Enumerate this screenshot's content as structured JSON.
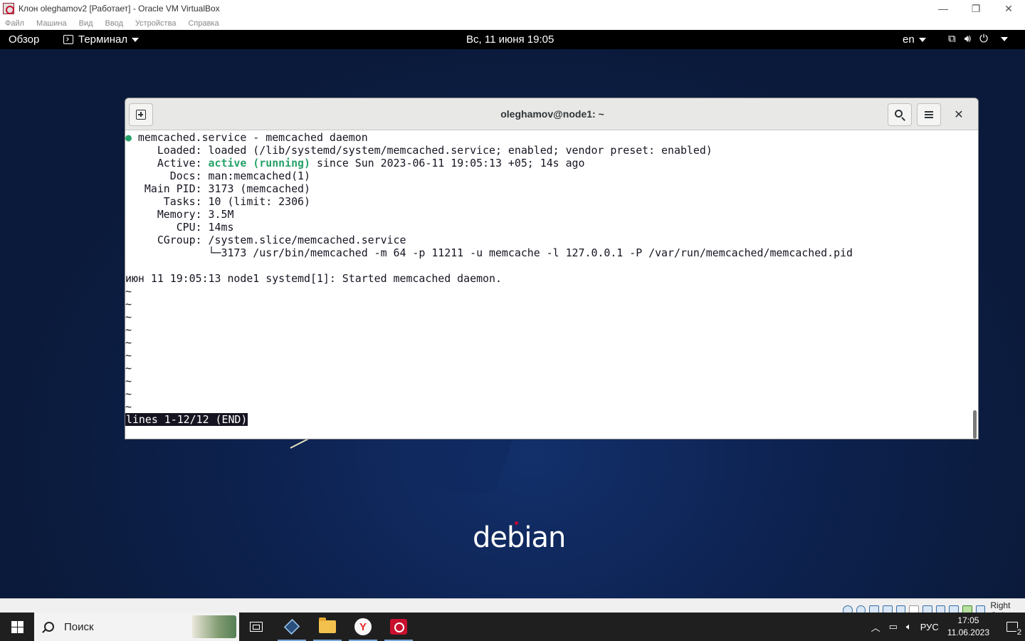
{
  "host_window": {
    "title": "Клон oleghamov2 [Работает] - Oracle VM VirtualBox",
    "controls": [
      "—",
      "❐",
      "✕"
    ]
  },
  "host_menu": [
    "Файл",
    "Машина",
    "Вид",
    "Ввод",
    "Устройства",
    "Справка"
  ],
  "gnome_bar": {
    "overview": "Обзор",
    "app_menu": "Терминал",
    "clock": "Вс, 11 июня  19:05",
    "lang": "en",
    "status_icons": [
      "network-icon",
      "volume-icon",
      "power-icon"
    ]
  },
  "terminal": {
    "title": "oleghamov@node1: ~",
    "lines": [
      {
        "pre": " memcached.service - memcached daemon",
        "dot": "●"
      },
      {
        "text": "     Loaded: loaded (/lib/systemd/system/memcached.service; enabled; vendor preset: enabled)"
      },
      {
        "pre": "     Active: ",
        "green": "active (running)",
        "post": " since Sun 2023-06-11 19:05:13 +05; 14s ago"
      },
      {
        "text": "       Docs: man:memcached(1)"
      },
      {
        "text": "   Main PID: 3173 (memcached)"
      },
      {
        "text": "      Tasks: 10 (limit: 2306)"
      },
      {
        "text": "     Memory: 3.5M"
      },
      {
        "text": "        CPU: 14ms"
      },
      {
        "text": "     CGroup: /system.slice/memcached.service"
      },
      {
        "text": "             └─3173 /usr/bin/memcached -m 64 -p 11211 -u memcache -l 127.0.0.1 -P /var/run/memcached/memcached.pid"
      },
      {
        "text": ""
      },
      {
        "text": "июн 11 19:05:13 node1 systemd[1]: Started memcached daemon."
      },
      {
        "text": "~"
      },
      {
        "text": "~"
      },
      {
        "text": "~"
      },
      {
        "text": "~"
      },
      {
        "text": "~"
      },
      {
        "text": "~"
      },
      {
        "text": "~"
      },
      {
        "text": "~"
      },
      {
        "text": "~"
      },
      {
        "text": "~"
      }
    ],
    "status_line": "lines 1-12/12 (END)"
  },
  "desktop": {
    "logo": "debian"
  },
  "vbox_status": {
    "host_key": "Right Ctrl"
  },
  "taskbar": {
    "search_placeholder": "Поиск",
    "tray_lang": "РУС",
    "time": "17:05",
    "date": "11.06.2023",
    "notifications": "2"
  }
}
